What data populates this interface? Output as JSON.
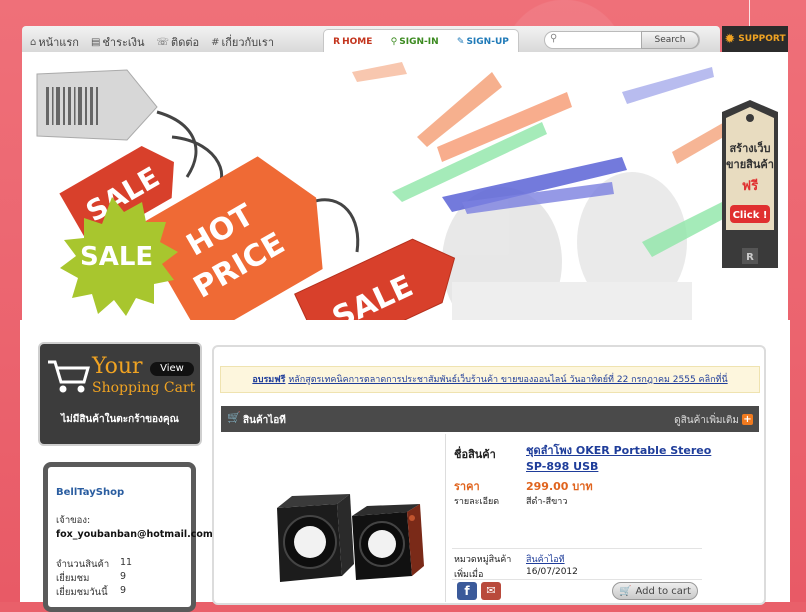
{
  "nav": {
    "items": [
      {
        "label": "หน้าแรก",
        "icon": "home-icon",
        "glyph": "⌂"
      },
      {
        "label": "ชำระเงิน",
        "icon": "payment-icon",
        "glyph": "▤"
      },
      {
        "label": "ติดต่อ",
        "icon": "contact-icon",
        "glyph": "☏"
      },
      {
        "label": "เกี่ยวกับเรา",
        "icon": "about-icon",
        "glyph": "#"
      }
    ],
    "auth": {
      "home": "HOME",
      "signin": "SIGN-IN",
      "signup": "SIGN-UP"
    },
    "search": {
      "placeholder": "",
      "button": "Search"
    },
    "support": "SUPPORT"
  },
  "banner": {
    "tags": [
      "SALE",
      "HOT PRICE",
      "SALE",
      "SALE"
    ],
    "promo": {
      "line1": "สร้างเว็บ",
      "line2": "ขายสินค้า",
      "line3": "ฟรี",
      "click": "Click !",
      "badge": "R"
    }
  },
  "cart": {
    "your": "Your",
    "shopping": "Shopping Cart",
    "view": "View",
    "empty": "ไม่มีสินค้าในตะกร้าของคุณ"
  },
  "shop": {
    "name": "BellTayShop",
    "owner_label": "เจ้าของ:",
    "email": "fox_youbanban@hotmail.com",
    "stats": [
      {
        "label": "จำนวนสินค้า",
        "value": "11"
      },
      {
        "label": "เยี่ยมชม",
        "value": "9"
      },
      {
        "label": "เยี่ยมชมวันนี้",
        "value": "9"
      }
    ]
  },
  "notice": {
    "strong": "อบรมฟรี",
    "text": "หลักสูตรเทคนิคการตลาดการประชาสัมพันธ์เว็บร้านค้า ขายของออนไลน์ วันอาทิตย์ที่ 22 กรกฎาคม 2555 คลิกที่นี่"
  },
  "section": {
    "title": "สินค้าไอที",
    "more": "ดูสินค้าเพิ่มเติม"
  },
  "product": {
    "name_label": "ชื่อสินค้า",
    "name": "ชุดลำโพง OKER Portable Stereo SP-898 USB",
    "price_label": "ราคา",
    "price": "299.00 บาท",
    "detail_label": "รายละเอียด",
    "detail": "สีดำ-สีขาว",
    "category_label": "หมวดหมู่สินค้า",
    "category": "สินค้าไอที",
    "added_label": "เพิ่มเมื่อ",
    "added": "16/07/2012",
    "add_to_cart": "Add to cart"
  },
  "colors": {
    "accent": "#f0a322",
    "link": "#1f3d9a",
    "price": "#e0641e",
    "background": "#e9606a"
  }
}
